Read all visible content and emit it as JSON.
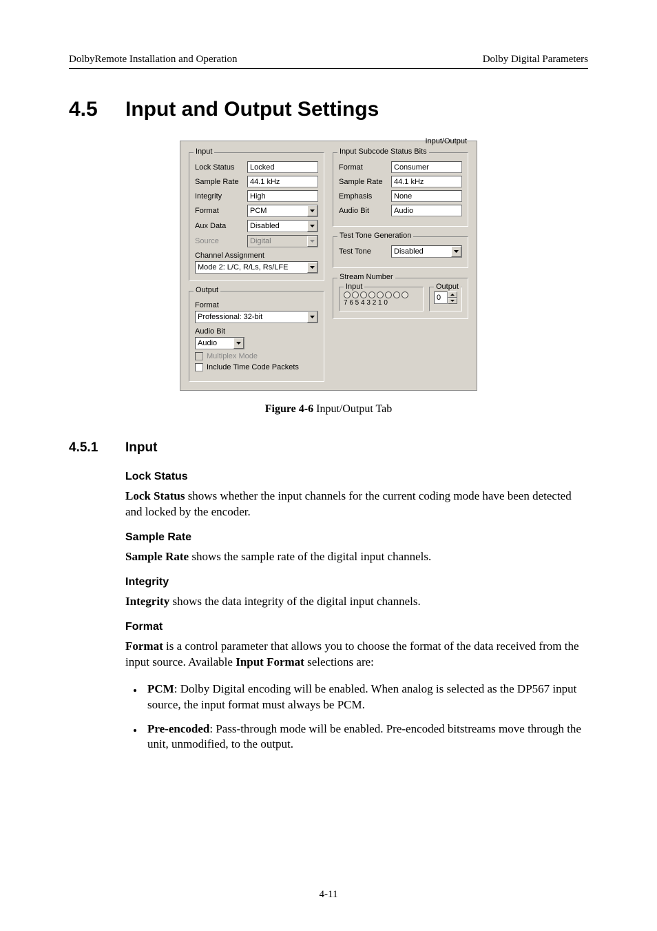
{
  "header": {
    "left": "DolbyRemote Installation and Operation",
    "right": "Dolby Digital Parameters"
  },
  "section": {
    "num": "4.5",
    "title": "Input and Output Settings"
  },
  "fig": {
    "label": "Figure 4-6",
    "caption": " Input/Output Tab"
  },
  "sub": {
    "num": "4.5.1",
    "title": "Input"
  },
  "body": {
    "lockstatus_h": "Lock Status",
    "lockstatus_p_b": "Lock Status",
    "lockstatus_p_rest": " shows whether the input channels for the current coding mode have been detected and locked by the encoder.",
    "samplerate_h": "Sample Rate",
    "samplerate_p_b": "Sample Rate",
    "samplerate_p_rest": " shows the sample rate of the digital input channels.",
    "integrity_h": "Integrity",
    "integrity_p_b": "Integrity",
    "integrity_p_rest": " shows the data integrity of the digital input channels.",
    "format_h": "Format",
    "format_p_b1": "Format",
    "format_p_mid": " is a control parameter that allows you to choose the format of the data received from the input source. Available ",
    "format_p_b2": "Input Format",
    "format_p_end": " selections are:",
    "li1_b": "PCM",
    "li1_rest": ": Dolby Digital encoding will be enabled. When analog is selected as the DP567 input source, the input format must always be PCM.",
    "li2_b": "Pre-encoded",
    "li2_rest": ": Pass-through mode will be enabled. Pre-encoded bitstreams move through the unit, unmodified, to the output."
  },
  "pagenum": "4-11",
  "ui": {
    "tab": "Input/Output",
    "input": {
      "legend": "Input",
      "lockstatus_l": "Lock Status",
      "lockstatus_v": "Locked",
      "samplerate_l": "Sample Rate",
      "samplerate_v": "44.1 kHz",
      "integrity_l": "Integrity",
      "integrity_v": "High",
      "format_l": "Format",
      "format_v": "PCM",
      "auxdata_l": "Aux Data",
      "auxdata_v": "Disabled",
      "source_l": "Source",
      "source_v": "Digital",
      "chassign_l": "Channel Assignment",
      "chassign_v": "Mode 2: L/C, R/Ls, Rs/LFE"
    },
    "output": {
      "legend": "Output",
      "format_l": "Format",
      "format_v": "Professional: 32-bit",
      "audiobit_l": "Audio Bit",
      "audiobit_v": "Audio",
      "multiplex_l": "Multiplex Mode",
      "timecode_l": "Include Time Code Packets"
    },
    "subcode": {
      "legend": "Input Subcode Status Bits",
      "format_l": "Format",
      "format_v": "Consumer",
      "samplerate_l": "Sample Rate",
      "samplerate_v": "44.1 kHz",
      "emphasis_l": "Emphasis",
      "emphasis_v": "None",
      "audiobit_l": "Audio Bit",
      "audiobit_v": "Audio"
    },
    "testtone": {
      "legend": "Test Tone Generation",
      "testtone_l": "Test Tone",
      "testtone_v": "Disabled"
    },
    "stream": {
      "legend": "Stream Number",
      "input_legend": "Input",
      "output_legend": "Output",
      "bitnums": "7 6 5 4 3 2 1 0",
      "output_v": "0"
    }
  }
}
